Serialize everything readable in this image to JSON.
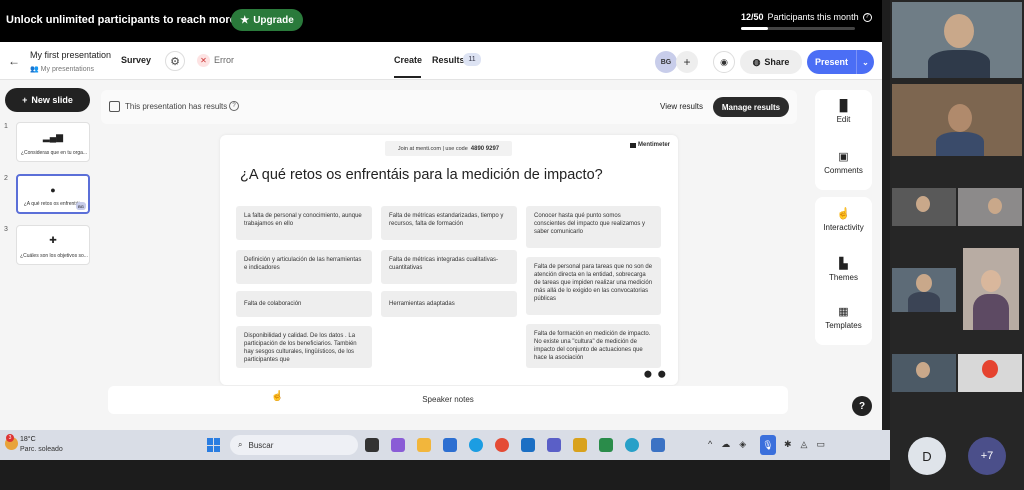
{
  "promo": {
    "text": "Unlock unlimited participants to reach more people.",
    "upgrade_label": "Upgrade",
    "participants_count": "12/50",
    "participants_text": "Participants this month",
    "participants_progress": 0.24
  },
  "header": {
    "title": "My first presentation",
    "breadcrumb": "My presentations",
    "survey_label": "Survey",
    "error_label": "Error",
    "tab_create": "Create",
    "tab_results": "Results",
    "results_count": "11",
    "avatar_initials": "BG",
    "share_label": "Share",
    "present_label": "Present"
  },
  "sidebar": {
    "new_slide_label": "New slide",
    "slides": [
      {
        "num": "1",
        "label": "¿Consideras que en tu orga..."
      },
      {
        "num": "2",
        "label": "¿A qué retos os enfrentáis...",
        "badge": "BG"
      },
      {
        "num": "3",
        "label": "¿Cuáles son los objetivos so..."
      }
    ]
  },
  "results_bar": {
    "text": "This presentation has results",
    "view_results": "View results",
    "manage_results": "Manage results"
  },
  "slide": {
    "join_text": "Join at menti.com | use code",
    "join_code": "4890 9297",
    "brand": "Mentimeter",
    "question": "¿A qué retos os enfrentáis para la medición de impacto?",
    "responses": [
      "La falta de personal y conocimiento, aunque trabajamos en ello",
      "Definición y articulación de las herramientas e indicadores",
      "Falta de colaboración",
      "Disponibilidad y calidad. De los datos . La participación de los beneficiarios. También hay sesgos culturales, lingüísticos, de los participantes que",
      "Falta de métricas estandarizadas, tiempo y recursos, falta de formación",
      "Falta de métricas integradas cualitativas-cuantitativas",
      "Herramientas adaptadas",
      "Conocer hasta qué punto somos conscientes del impacto que realizamos y saber comunicarlo",
      "Falta de personal para tareas que no son de atención directa en la entidad, sobrecarga de tareas que impiden realizar una medición más allá de lo exigido en las convocatorias públicas",
      "Falta de formación en medición de impacto. No existe una \"cultura\" de medición de impacto del conjunto de actuaciones que hace la asociación"
    ]
  },
  "speaker_notes_label": "Speaker notes",
  "help_label": "?",
  "right_panel": {
    "edit": "Edit",
    "comments": "Comments",
    "interactivity": "Interactivity",
    "themes": "Themes",
    "templates": "Templates"
  },
  "taskbar": {
    "temperature": "18°C",
    "weather": "Parc. soleado",
    "weather_badge": "3",
    "search_label": "Buscar"
  },
  "meeting": {
    "self_initial": "D",
    "more_count": "+7"
  },
  "icons": {
    "back": "arrow-left-icon",
    "gear": "gear-icon",
    "eye": "eye-icon",
    "share": "globe-icon",
    "mic": "microphone-icon"
  },
  "colors": {
    "accent": "#4b6ef5",
    "upgrade": "#2a7a3b",
    "dark": "#222222"
  }
}
